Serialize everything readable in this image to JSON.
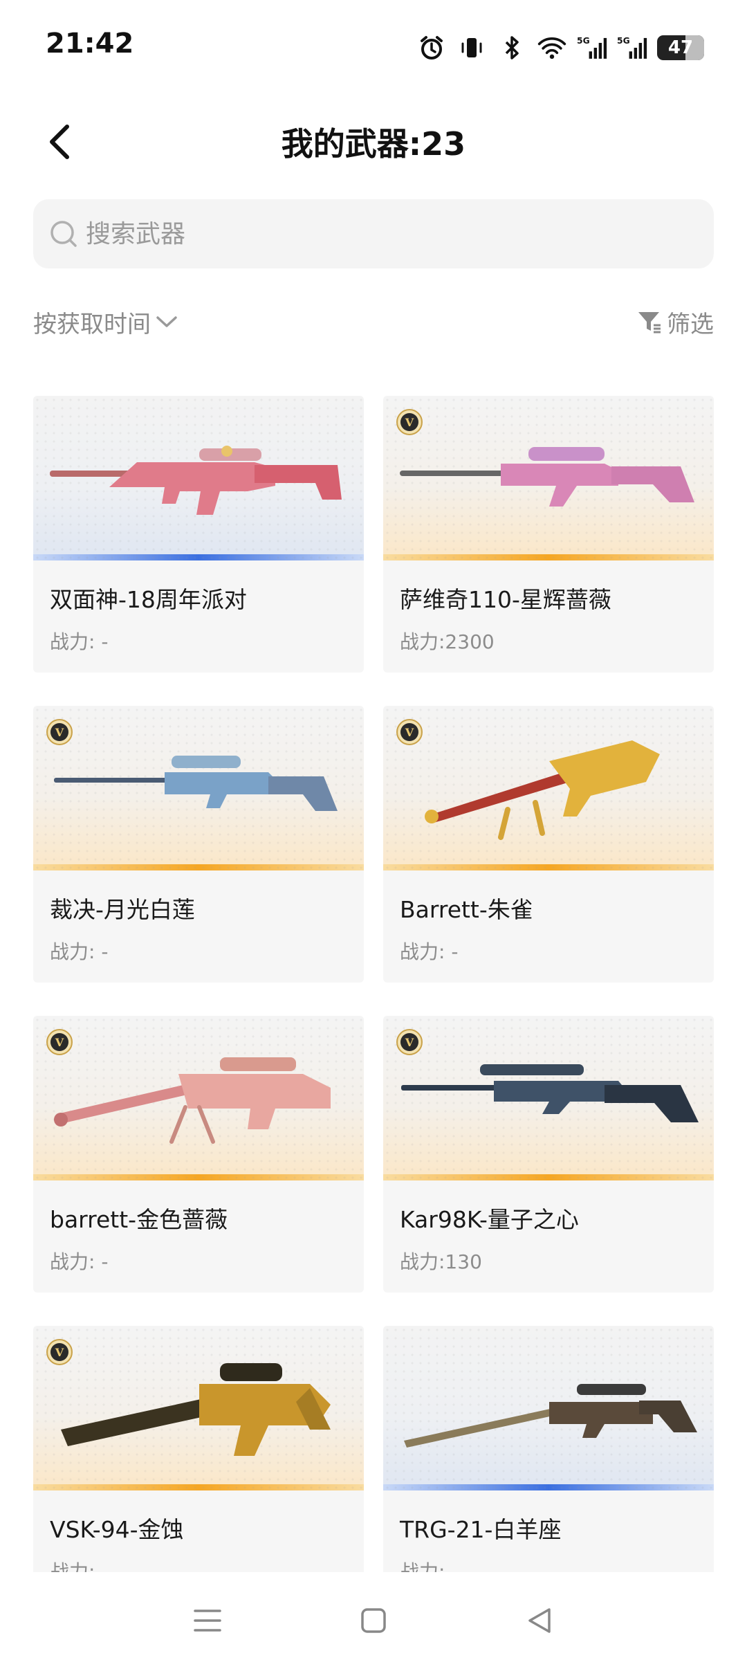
{
  "status_bar": {
    "time": "21:42",
    "battery": "47"
  },
  "header": {
    "title": "我的武器:23"
  },
  "search": {
    "placeholder": "搜索武器"
  },
  "controls": {
    "sort_label": "按获取时间",
    "filter_label": "筛选"
  },
  "colors": {
    "rare_blue": "#3b6fe0",
    "legend_gold": "#f5a623"
  },
  "weapons": [
    {
      "name": "双面神-18周年派对",
      "power": "战力: -",
      "tier": "blue",
      "vip": false
    },
    {
      "name": "萨维奇110-星辉蔷薇",
      "power": "战力:2300",
      "tier": "gold",
      "vip": true
    },
    {
      "name": "裁决-月光白莲",
      "power": "战力: -",
      "tier": "gold",
      "vip": true
    },
    {
      "name": "Barrett-朱雀",
      "power": "战力: -",
      "tier": "gold",
      "vip": true
    },
    {
      "name": "barrett-金色蔷薇",
      "power": "战力: -",
      "tier": "gold",
      "vip": true
    },
    {
      "name": "Kar98K-量子之心",
      "power": "战力:130",
      "tier": "gold",
      "vip": true
    },
    {
      "name": "VSK-94-金蚀",
      "power": "战力: -",
      "tier": "gold",
      "vip": true
    },
    {
      "name": "TRG-21-白羊座",
      "power": "战力: -",
      "tier": "blue",
      "vip": false
    }
  ],
  "icons": {
    "back": "chevron-left-icon",
    "search": "search-icon",
    "sort": "chevron-down-icon",
    "filter": "filter-icon",
    "badge": "v-badge-icon"
  }
}
